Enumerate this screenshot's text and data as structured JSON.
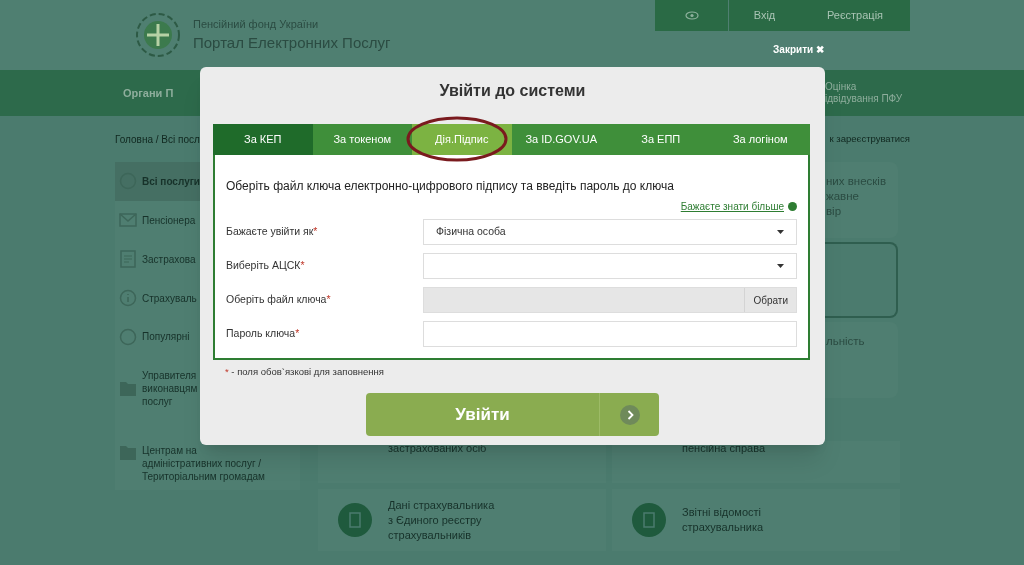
{
  "header": {
    "org": "Пенсійний фонд України",
    "portal": "Портал Електронних Послуг",
    "login": "Вхід",
    "register": "Реєстрація",
    "close": "Закрити ✖"
  },
  "nav": {
    "left": "Органи П",
    "right": [
      "Оцінка",
      "ідвідування ПФУ"
    ]
  },
  "breadcrumb": {
    "left": "Головна / Всі посл",
    "right": "к зареєструватися"
  },
  "sidebar": [
    {
      "lines": [
        "Всі послуги"
      ],
      "selected": true
    },
    {
      "lines": [
        "Пенсіонера"
      ],
      "selected": false
    },
    {
      "lines": [
        "Застрахова"
      ],
      "selected": false
    },
    {
      "lines": [
        "Страхуваль"
      ],
      "selected": false
    },
    {
      "lines": [
        "Популярні"
      ],
      "selected": false
    },
    {
      "lines": [
        "Управителя",
        "виконавцям",
        "послуг"
      ],
      "selected": false
    },
    {
      "lines": [
        "Центрам на",
        "адміністративних послуг /",
        "Територіальним громадам"
      ],
      "selected": false
    }
  ],
  "side_fragments": [
    {
      "lines": [
        "них внесків",
        "жавне",
        "вір"
      ],
      "outlined": false
    },
    {
      "outlined": true
    },
    {
      "lines": [
        "льність"
      ],
      "outlined": false
    }
  ],
  "cards": [
    {
      "lines": [
        "застрахованих осіб"
      ],
      "kind": "partial"
    },
    {
      "lines": [
        "пенсійна справа"
      ],
      "kind": "partial"
    },
    {
      "lines": [
        "Дані страхувальника",
        "з Єдиного реєстру",
        "страхувальників"
      ],
      "kind": "full"
    },
    {
      "lines": [
        "Звітні відомості",
        "страхувальника"
      ],
      "kind": "full"
    }
  ],
  "modal": {
    "title": "Увійти до системи",
    "tabs": [
      {
        "label": "За КЕП",
        "selected": true,
        "circled": false
      },
      {
        "label": "За токеном",
        "selected": false,
        "circled": false
      },
      {
        "label": "Дія.Підпис",
        "selected": false,
        "circled": true
      },
      {
        "label": "За ID.GOV.UA",
        "selected": false,
        "circled": false
      },
      {
        "label": "За ЕПП",
        "selected": false,
        "circled": false
      },
      {
        "label": "За логіном",
        "selected": false,
        "circled": false
      }
    ],
    "heading": "Оберіть файл ключа електронно-цифрового підпису та введіть пароль до ключа",
    "help_link": "Бажаєте знати більше",
    "fields": [
      {
        "kind": "select",
        "label": "Бажаєте увійти як",
        "required_mark": "*",
        "value": "Фізична особа"
      },
      {
        "kind": "select",
        "label": "Виберіть АЦСК",
        "required_mark": "*"
      },
      {
        "kind": "file",
        "label": "Оберіть файл ключа",
        "required_mark": "*",
        "button": "Обрати"
      },
      {
        "kind": "password",
        "label": "Пароль ключа",
        "required_mark": "*"
      }
    ],
    "note_mark": "*",
    "note": "- поля обов`язкові для заповнення",
    "submit": "Увійти"
  }
}
